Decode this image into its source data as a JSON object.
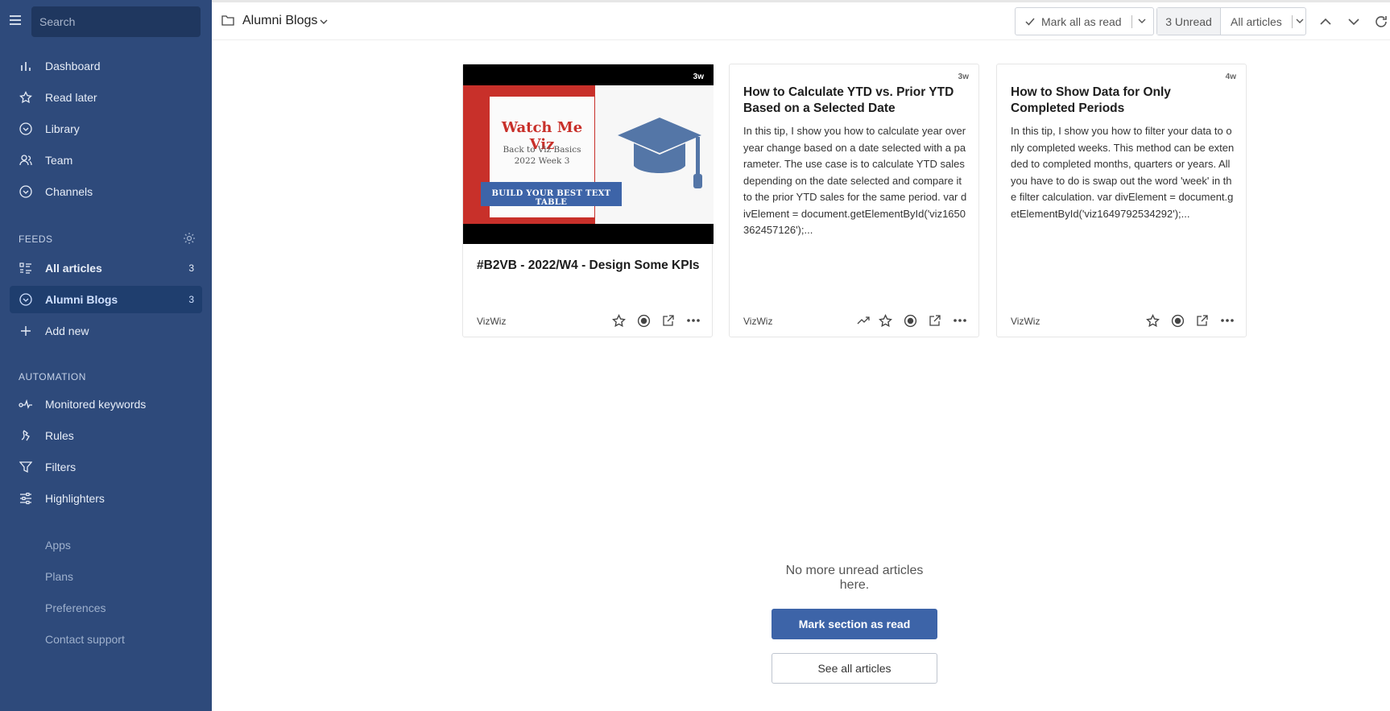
{
  "sidebar": {
    "search_placeholder": "Search",
    "nav": [
      {
        "label": "Dashboard",
        "icon": "bar-chart-icon"
      },
      {
        "label": "Read later",
        "icon": "star-icon"
      },
      {
        "label": "Library",
        "icon": "circle-chevron-icon"
      },
      {
        "label": "Team",
        "icon": "team-icon"
      },
      {
        "label": "Channels",
        "icon": "circle-chevron-icon"
      }
    ],
    "feeds_heading": "FEEDS",
    "feeds": [
      {
        "label": "All articles",
        "count": "3",
        "icon": "list-icon"
      },
      {
        "label": "Alumni Blogs",
        "count": "3",
        "icon": "circle-chevron-icon"
      },
      {
        "label": "Add new",
        "icon": "plus-icon"
      }
    ],
    "automation_heading": "AUTOMATION",
    "automation": [
      {
        "label": "Monitored keywords",
        "icon": "pulse-icon"
      },
      {
        "label": "Rules",
        "icon": "rules-icon"
      },
      {
        "label": "Filters",
        "icon": "filter-icon"
      },
      {
        "label": "Highlighters",
        "icon": "highlighter-icon"
      }
    ],
    "footer": [
      {
        "label": "Apps"
      },
      {
        "label": "Plans"
      },
      {
        "label": "Preferences"
      },
      {
        "label": "Contact support"
      }
    ]
  },
  "header": {
    "title": "Alumni Blogs",
    "mark_all": "Mark all as read",
    "unread": "3 Unread",
    "filter": "All articles"
  },
  "cards": [
    {
      "age": "3w",
      "title": "#B2VB - 2022/W4 - Design Some KPIs",
      "source": "VizWiz",
      "thumb": {
        "heading": "Watch Me Viz",
        "sub1": "Back to Viz Basics",
        "sub2": "2022 Week 3",
        "banner": "BUILD YOUR BEST TEXT TABLE"
      }
    },
    {
      "age": "3w",
      "title": "How to Calculate YTD vs. Prior YTD Based on a Selected Date",
      "body": "In this tip, I show you how to calculate year over year change based on a date selected with a parameter. The use case is to calculate YTD sales depending on the date selected and compare it to the prior YTD sales for the same period. var divElement = document.getElementById('viz1650362457126');...",
      "source": "VizWiz"
    },
    {
      "age": "4w",
      "title": "How to Show Data for Only Completed Periods",
      "body": "In this tip, I show you how to filter your data to only completed weeks. This method can be extended to completed months, quarters or years. All you have to do is swap out the word 'week' in the filter calculation. var divElement = document.getElementById('viz1649792534292');...",
      "source": "VizWiz"
    }
  ],
  "empty_state": {
    "message": "No more unread articles here.",
    "primary": "Mark section as read",
    "secondary": "See all articles"
  },
  "colors": {
    "sidebar": "#2e4a7b",
    "active": "#1f3e6e",
    "accent": "#3d64a8"
  }
}
